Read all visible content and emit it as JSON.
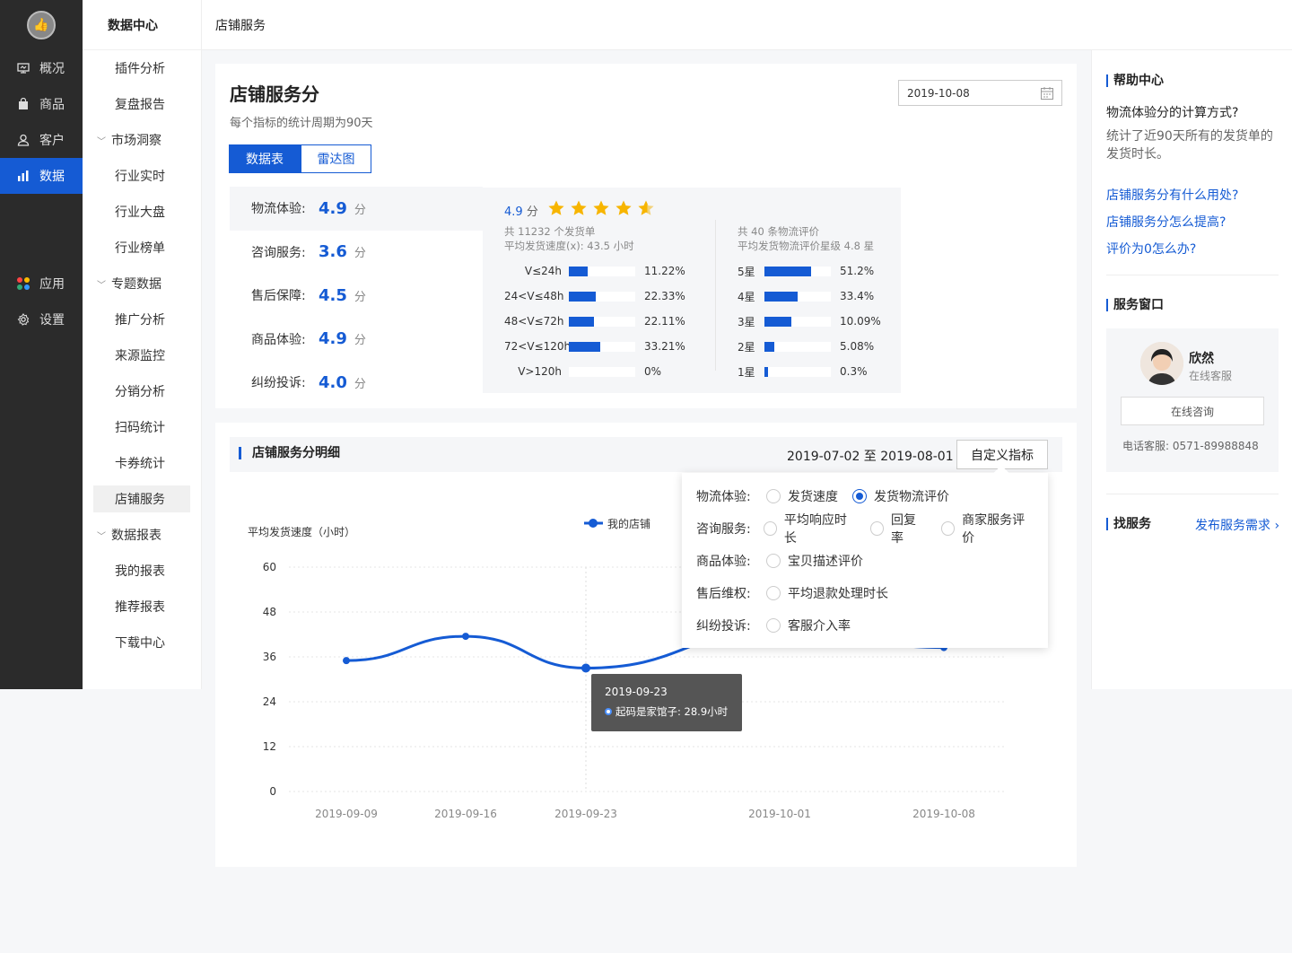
{
  "rail": {
    "items": [
      {
        "label": "概况",
        "icon": "overview-icon"
      },
      {
        "label": "商品",
        "icon": "bag-icon"
      },
      {
        "label": "客户",
        "icon": "user-icon"
      },
      {
        "label": "数据",
        "icon": "bar-chart-icon",
        "active": true
      },
      {
        "label": "应用",
        "icon": "apps-icon"
      },
      {
        "label": "设置",
        "icon": "gear-icon"
      }
    ]
  },
  "subnav": {
    "title": "数据中心",
    "items": {
      "plugin": "插件分析",
      "review": "复盘报告",
      "market": "市场洞察",
      "realtime": "行业实时",
      "overview": "行业大盘",
      "rank": "行业榜单",
      "topic": "专题数据",
      "promo": "推广分析",
      "source": "来源监控",
      "dist": "分销分析",
      "scan": "扫码统计",
      "coupon": "卡券统计",
      "store": "店铺服务",
      "reports": "数据报表",
      "mine": "我的报表",
      "recommend": "推荐报表",
      "download": "下载中心"
    }
  },
  "topbar": {
    "title": "店铺服务"
  },
  "score_card": {
    "title": "店铺服务分",
    "subtitle": "每个指标的统计周期为90天",
    "date": "2019-10-08",
    "tabs": {
      "table": "数据表",
      "radar": "雷达图"
    },
    "metrics": [
      {
        "label": "物流体验:",
        "value": "4.9",
        "unit": "分"
      },
      {
        "label": "咨询服务:",
        "value": "3.6",
        "unit": "分"
      },
      {
        "label": "售后保障:",
        "value": "4.5",
        "unit": "分"
      },
      {
        "label": "商品体验:",
        "value": "4.9",
        "unit": "分"
      },
      {
        "label": "纠纷投诉:",
        "value": "4.0",
        "unit": "分"
      }
    ],
    "detail": {
      "score": "4.9",
      "unit": "分",
      "stars": 4.5,
      "left_note1": "共 11232 个发货单",
      "left_note2": "平均发货速度(x): 43.5 小时",
      "right_note1": "共 40 条物流评价",
      "right_note2": "平均发货物流评价星级 4.8 星",
      "speed": [
        {
          "label": "V≤24h",
          "pct": "11.22%",
          "frac": 0.28
        },
        {
          "label": "24<V≤48h",
          "pct": "22.33%",
          "frac": 0.4
        },
        {
          "label": "48<V≤72h",
          "pct": "22.11%",
          "frac": 0.38
        },
        {
          "label": "72<V≤120h",
          "pct": "33.21%",
          "frac": 0.47
        },
        {
          "label": "V>120h",
          "pct": "0%",
          "frac": 0
        }
      ],
      "rating": [
        {
          "label": "5星",
          "pct": "51.2%",
          "frac": 0.7
        },
        {
          "label": "4星",
          "pct": "33.4%",
          "frac": 0.5
        },
        {
          "label": "3星",
          "pct": "10.09%",
          "frac": 0.4
        },
        {
          "label": "2星",
          "pct": "5.08%",
          "frac": 0.15
        },
        {
          "label": "1星",
          "pct": "0.3%",
          "frac": 0.06
        }
      ]
    }
  },
  "detail_card": {
    "title": "店铺服务分明细",
    "range": "2019-07-02 至 2019-08-01",
    "custom_button": "自定义指标"
  },
  "popover": {
    "rows": [
      {
        "label": "物流体验:",
        "options": [
          {
            "text": "发货速度",
            "on": false
          },
          {
            "text": "发货物流评价",
            "on": true
          }
        ]
      },
      {
        "label": "咨询服务:",
        "options": [
          {
            "text": "平均响应时长",
            "on": false
          },
          {
            "text": "回复率",
            "on": false
          },
          {
            "text": "商家服务评价",
            "on": false
          }
        ]
      },
      {
        "label": "商品体验:",
        "options": [
          {
            "text": "宝贝描述评价",
            "on": false
          }
        ]
      },
      {
        "label": "售后维权:",
        "options": [
          {
            "text": "平均退款处理时长",
            "on": false
          }
        ]
      },
      {
        "label": "纠纷投诉:",
        "options": [
          {
            "text": "客服介入率",
            "on": false
          }
        ]
      }
    ]
  },
  "tooltip": {
    "date": "2019-09-23",
    "text": "起码是家馆子: 28.9小时"
  },
  "chart_data": {
    "type": "line",
    "ylabel": "平均发货速度（小时）",
    "legend": "我的店铺",
    "yticks": [
      "0",
      "12",
      "24",
      "36",
      "48",
      "60"
    ],
    "ylim": [
      0,
      60
    ],
    "x": [
      "2019-09-09",
      "2019-09-16",
      "2019-09-23",
      "2019-10-01",
      "2019-10-08"
    ],
    "series": [
      {
        "name": "我的店铺",
        "values": [
          35,
          41.5,
          33,
          43,
          38.5
        ]
      }
    ],
    "color": "#155bd4"
  },
  "help": {
    "title": "帮助中心",
    "question": "物流体验分的计算方式?",
    "answer": "统计了近90天所有的发货单的发货时长。",
    "links": [
      "店铺服务分有什么用处?",
      "店铺服务分怎么提高?",
      "评价为0怎么办?"
    ]
  },
  "service": {
    "title": "服务窗口",
    "name": "欣然",
    "role": "在线客服",
    "button": "在线咨询",
    "phone": "电话客服: 0571-89988848"
  },
  "find": {
    "title": "找服务",
    "link": "发布服务需求"
  }
}
